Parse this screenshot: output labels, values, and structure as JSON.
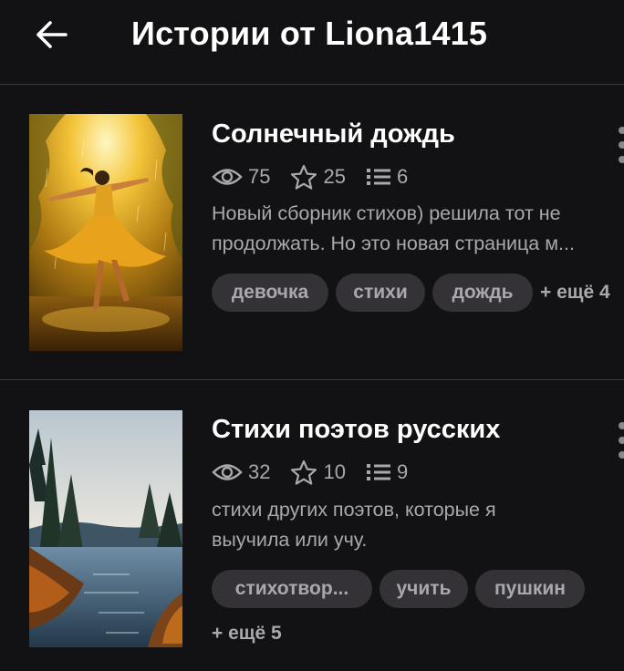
{
  "header": {
    "title": "Истории от Liona1415",
    "back_icon": "arrow-left-icon"
  },
  "stories": [
    {
      "title": "Солнечный дождь",
      "cover": "girl-dancing-in-rain-cover",
      "views": "75",
      "stars": "25",
      "parts": "6",
      "description_lines": [
        "Новый сборник стихов) решила тот не",
        "продолжать. Но это новая страница м..."
      ],
      "tags": [
        "девочка",
        "стихи",
        "дождь"
      ],
      "more_tags": "+ ещё 4"
    },
    {
      "title": "Стихи поэтов русских",
      "cover": "forest-lake-painting-cover",
      "views": "32",
      "stars": "10",
      "parts": "9",
      "description_lines": [
        "стихи других поэтов, которые я",
        "выучила или учу."
      ],
      "tags": [
        "стихотвор...",
        "учить",
        "пушкин"
      ],
      "more_tags": "+ ещё 5"
    }
  ],
  "colors": {
    "background": "#121113",
    "text_primary": "#ffffff",
    "text_secondary": "#a9a8ad",
    "tag_background": "#343237",
    "divider": "#3a393c"
  }
}
